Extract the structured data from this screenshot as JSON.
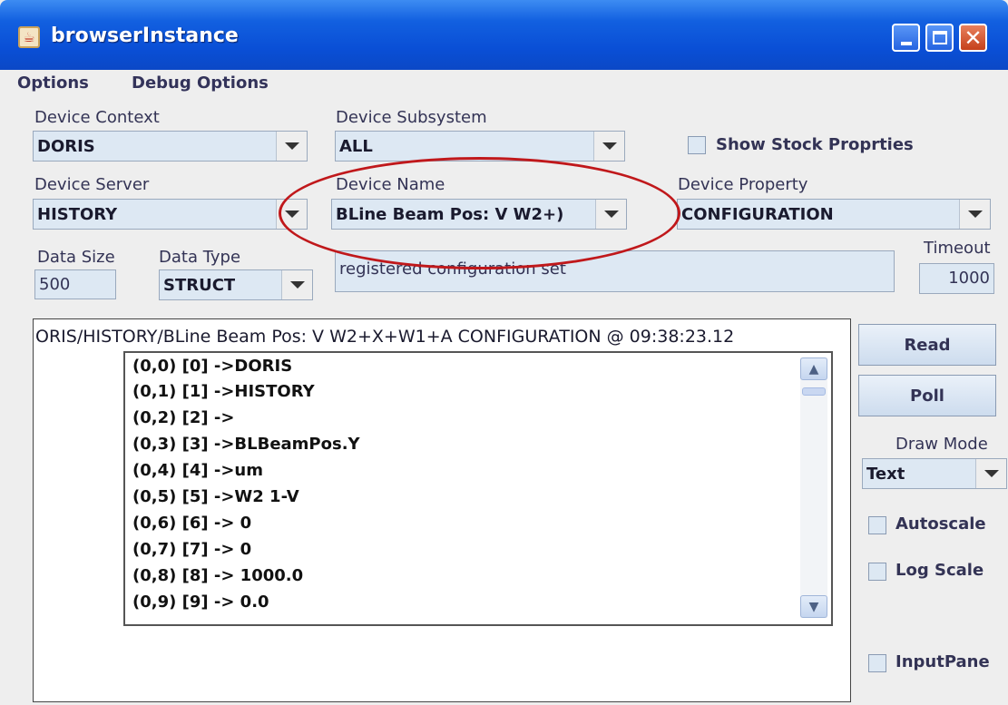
{
  "window": {
    "title": "browserInstance",
    "icon": "java-cup-icon",
    "controls": [
      "minimize",
      "maximize",
      "close"
    ],
    "close_glyph": "✕"
  },
  "menu": {
    "items": [
      "Options",
      "Debug Options"
    ]
  },
  "device_context": {
    "label": "Device Context",
    "value": "DORIS"
  },
  "device_subsystem": {
    "label": "Device Subsystem",
    "value": "ALL"
  },
  "show_stock": {
    "label": "Show Stock Proprties",
    "checked": false
  },
  "device_server": {
    "label": "Device Server",
    "value": "HISTORY"
  },
  "device_name": {
    "label": "Device Name",
    "value": "BLine Beam Pos: V W2+)"
  },
  "device_property": {
    "label": "Device Property",
    "value": "CONFIGURATION"
  },
  "data_size": {
    "label": "Data Size",
    "value": "500"
  },
  "data_type": {
    "label": "Data Type",
    "value": "STRUCT"
  },
  "description": {
    "value": "registered configuration set"
  },
  "timeout": {
    "label": "Timeout",
    "value": "1000"
  },
  "output": {
    "header": "ORIS/HISTORY/BLine Beam Pos: V W2+X+W1+A CONFIGURATION @ 09:38:23.12",
    "rows": [
      "(0,0)  [0] ->DORIS",
      "(0,1)  [1] ->HISTORY",
      "(0,2)  [2] ->",
      "(0,3)  [3] ->BLBeamPos.Y",
      "(0,4)  [4] ->um",
      "(0,5)  [5] ->W2 1-V",
      "(0,6)  [6] -> 0",
      "(0,7)  [7] -> 0",
      "(0,8)  [8] -> 1000.0",
      "(0,9)  [9] -> 0.0"
    ]
  },
  "actions": {
    "read": "Read",
    "poll": "Poll"
  },
  "draw_mode": {
    "label": "Draw Mode",
    "value": "Text"
  },
  "autoscale": {
    "label": "Autoscale",
    "checked": false
  },
  "log_scale": {
    "label": "Log Scale",
    "checked": false
  },
  "input_pane": {
    "label": "InputPane",
    "checked": false
  },
  "colors": {
    "titlebar": "#0a4fd6",
    "field_bg": "#dde8f3",
    "highlight": "#c0181b"
  }
}
